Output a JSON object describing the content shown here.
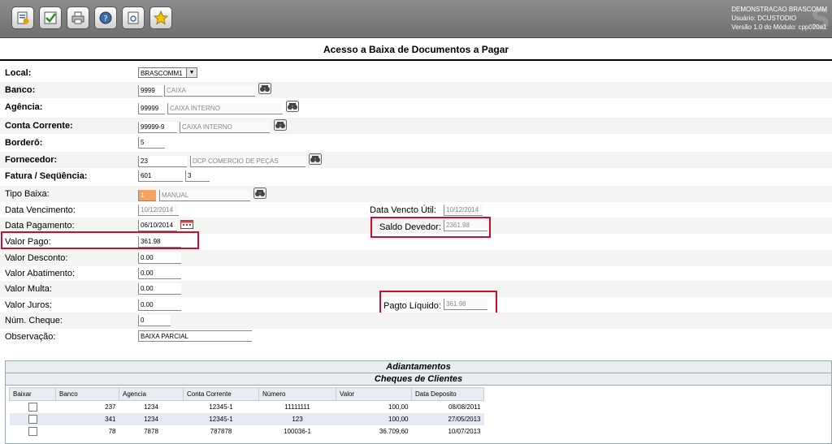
{
  "header": {
    "company": "DEMONSTRACAO BRASCOMM",
    "user_line": "Usuário: DCUSTODIO",
    "version_line": "Versão 1.0 do Módulo: cpp020a1",
    "watermark": "S"
  },
  "toolbar": [
    "new-icon",
    "check-icon",
    "print-icon",
    "help-icon",
    "document-icon",
    "favorite-star-icon"
  ],
  "title": "Acesso a Baixa de Documentos a Pagar",
  "form": {
    "local_label": "Local:",
    "local_value": "BRASCOMM1",
    "banco_label": "Banco:",
    "banco_code": "9999",
    "banco_name": "CAIXA",
    "agencia_label": "Agência:",
    "agencia_code": "99999",
    "agencia_name": "CAIXA INTERNO",
    "conta_label": "Conta Corrente:",
    "conta_code": "99999-9",
    "conta_name": "CAIXA INTERNO",
    "bordero_label": "Borderô:",
    "bordero_value": "5",
    "fornecedor_label": "Fornecedor:",
    "fornecedor_code": "23",
    "fornecedor_name": "DCP COMERCIO DE PEÇAS",
    "fatura_label": "Fatura / Seqüência:",
    "fatura_value": "601",
    "sequencia_value": "3",
    "tipo_label": "Tipo Baixa:",
    "tipo_code": "1",
    "tipo_name": "MANUAL",
    "venc_label": "Data Vencimento:",
    "venc_value": "10/12/2014",
    "venc_util_label": "Data Vencto Útil:",
    "venc_util_value": "10/12/2014",
    "pag_label": "Data Pagamento:",
    "pag_value": "06/10/2014",
    "saldo_label": "Saldo Devedor:",
    "saldo_value": "2361.98",
    "valor_pago_label": "Valor Pago:",
    "valor_pago_value": "361.98",
    "desconto_label": "Valor Desconto:",
    "desconto_value": "0.00",
    "abatimento_label": "Valor Abatimento:",
    "abatimento_value": "0.00",
    "multa_label": "Valor Multa:",
    "multa_value": "0.00",
    "juros_label": "Valor Juros:",
    "juros_value": "0.00",
    "pagto_liquido_label": "Pagto Líquido:",
    "pagto_liquido_value": "361.98",
    "cheque_label": "Núm. Cheque:",
    "cheque_value": "0",
    "obs_label": "Observação:",
    "obs_value": "BAIXA PARCIAL"
  },
  "adiantamentos_title": "Adiantamentos",
  "cheques_title": "Cheques de Clientes",
  "columns": [
    "Baixar",
    "Banco",
    "Agencia",
    "Conta Corrente",
    "Número",
    "Valor",
    "Data Deposito"
  ],
  "rows": [
    {
      "banco": "237",
      "agencia": "1234",
      "conta": "12345-1",
      "numero": "11111111",
      "valor": "100,00",
      "data": "08/08/2011"
    },
    {
      "banco": "341",
      "agencia": "1234",
      "conta": "12345-1",
      "numero": "123",
      "valor": "100,00",
      "data": "27/05/2013"
    },
    {
      "banco": "78",
      "agencia": "7878",
      "conta": "787878",
      "numero": "100036-1",
      "valor": "36.709,60",
      "data": "10/07/2013"
    }
  ],
  "colors": {
    "highlight_box": "#c8102e",
    "readonly_orange": "#f4a460",
    "toolbar": "#7f7f7f"
  }
}
